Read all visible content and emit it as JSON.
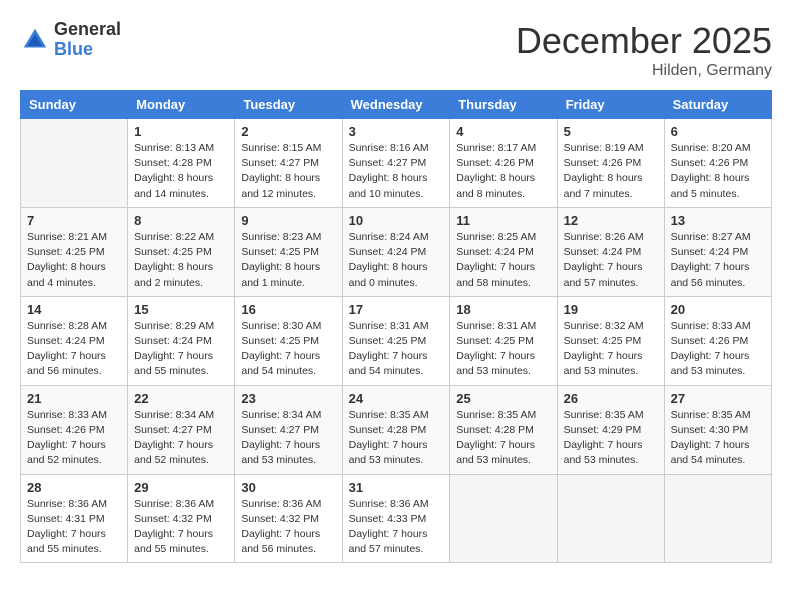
{
  "header": {
    "logo_general": "General",
    "logo_blue": "Blue",
    "month_title": "December 2025",
    "location": "Hilden, Germany"
  },
  "weekdays": [
    "Sunday",
    "Monday",
    "Tuesday",
    "Wednesday",
    "Thursday",
    "Friday",
    "Saturday"
  ],
  "weeks": [
    [
      {
        "day": "",
        "info": ""
      },
      {
        "day": "1",
        "info": "Sunrise: 8:13 AM\nSunset: 4:28 PM\nDaylight: 8 hours\nand 14 minutes."
      },
      {
        "day": "2",
        "info": "Sunrise: 8:15 AM\nSunset: 4:27 PM\nDaylight: 8 hours\nand 12 minutes."
      },
      {
        "day": "3",
        "info": "Sunrise: 8:16 AM\nSunset: 4:27 PM\nDaylight: 8 hours\nand 10 minutes."
      },
      {
        "day": "4",
        "info": "Sunrise: 8:17 AM\nSunset: 4:26 PM\nDaylight: 8 hours\nand 8 minutes."
      },
      {
        "day": "5",
        "info": "Sunrise: 8:19 AM\nSunset: 4:26 PM\nDaylight: 8 hours\nand 7 minutes."
      },
      {
        "day": "6",
        "info": "Sunrise: 8:20 AM\nSunset: 4:26 PM\nDaylight: 8 hours\nand 5 minutes."
      }
    ],
    [
      {
        "day": "7",
        "info": "Sunrise: 8:21 AM\nSunset: 4:25 PM\nDaylight: 8 hours\nand 4 minutes."
      },
      {
        "day": "8",
        "info": "Sunrise: 8:22 AM\nSunset: 4:25 PM\nDaylight: 8 hours\nand 2 minutes."
      },
      {
        "day": "9",
        "info": "Sunrise: 8:23 AM\nSunset: 4:25 PM\nDaylight: 8 hours\nand 1 minute."
      },
      {
        "day": "10",
        "info": "Sunrise: 8:24 AM\nSunset: 4:24 PM\nDaylight: 8 hours\nand 0 minutes."
      },
      {
        "day": "11",
        "info": "Sunrise: 8:25 AM\nSunset: 4:24 PM\nDaylight: 7 hours\nand 58 minutes."
      },
      {
        "day": "12",
        "info": "Sunrise: 8:26 AM\nSunset: 4:24 PM\nDaylight: 7 hours\nand 57 minutes."
      },
      {
        "day": "13",
        "info": "Sunrise: 8:27 AM\nSunset: 4:24 PM\nDaylight: 7 hours\nand 56 minutes."
      }
    ],
    [
      {
        "day": "14",
        "info": "Sunrise: 8:28 AM\nSunset: 4:24 PM\nDaylight: 7 hours\nand 56 minutes."
      },
      {
        "day": "15",
        "info": "Sunrise: 8:29 AM\nSunset: 4:24 PM\nDaylight: 7 hours\nand 55 minutes."
      },
      {
        "day": "16",
        "info": "Sunrise: 8:30 AM\nSunset: 4:25 PM\nDaylight: 7 hours\nand 54 minutes."
      },
      {
        "day": "17",
        "info": "Sunrise: 8:31 AM\nSunset: 4:25 PM\nDaylight: 7 hours\nand 54 minutes."
      },
      {
        "day": "18",
        "info": "Sunrise: 8:31 AM\nSunset: 4:25 PM\nDaylight: 7 hours\nand 53 minutes."
      },
      {
        "day": "19",
        "info": "Sunrise: 8:32 AM\nSunset: 4:25 PM\nDaylight: 7 hours\nand 53 minutes."
      },
      {
        "day": "20",
        "info": "Sunrise: 8:33 AM\nSunset: 4:26 PM\nDaylight: 7 hours\nand 53 minutes."
      }
    ],
    [
      {
        "day": "21",
        "info": "Sunrise: 8:33 AM\nSunset: 4:26 PM\nDaylight: 7 hours\nand 52 minutes."
      },
      {
        "day": "22",
        "info": "Sunrise: 8:34 AM\nSunset: 4:27 PM\nDaylight: 7 hours\nand 52 minutes."
      },
      {
        "day": "23",
        "info": "Sunrise: 8:34 AM\nSunset: 4:27 PM\nDaylight: 7 hours\nand 53 minutes."
      },
      {
        "day": "24",
        "info": "Sunrise: 8:35 AM\nSunset: 4:28 PM\nDaylight: 7 hours\nand 53 minutes."
      },
      {
        "day": "25",
        "info": "Sunrise: 8:35 AM\nSunset: 4:28 PM\nDaylight: 7 hours\nand 53 minutes."
      },
      {
        "day": "26",
        "info": "Sunrise: 8:35 AM\nSunset: 4:29 PM\nDaylight: 7 hours\nand 53 minutes."
      },
      {
        "day": "27",
        "info": "Sunrise: 8:35 AM\nSunset: 4:30 PM\nDaylight: 7 hours\nand 54 minutes."
      }
    ],
    [
      {
        "day": "28",
        "info": "Sunrise: 8:36 AM\nSunset: 4:31 PM\nDaylight: 7 hours\nand 55 minutes."
      },
      {
        "day": "29",
        "info": "Sunrise: 8:36 AM\nSunset: 4:32 PM\nDaylight: 7 hours\nand 55 minutes."
      },
      {
        "day": "30",
        "info": "Sunrise: 8:36 AM\nSunset: 4:32 PM\nDaylight: 7 hours\nand 56 minutes."
      },
      {
        "day": "31",
        "info": "Sunrise: 8:36 AM\nSunset: 4:33 PM\nDaylight: 7 hours\nand 57 minutes."
      },
      {
        "day": "",
        "info": ""
      },
      {
        "day": "",
        "info": ""
      },
      {
        "day": "",
        "info": ""
      }
    ]
  ]
}
